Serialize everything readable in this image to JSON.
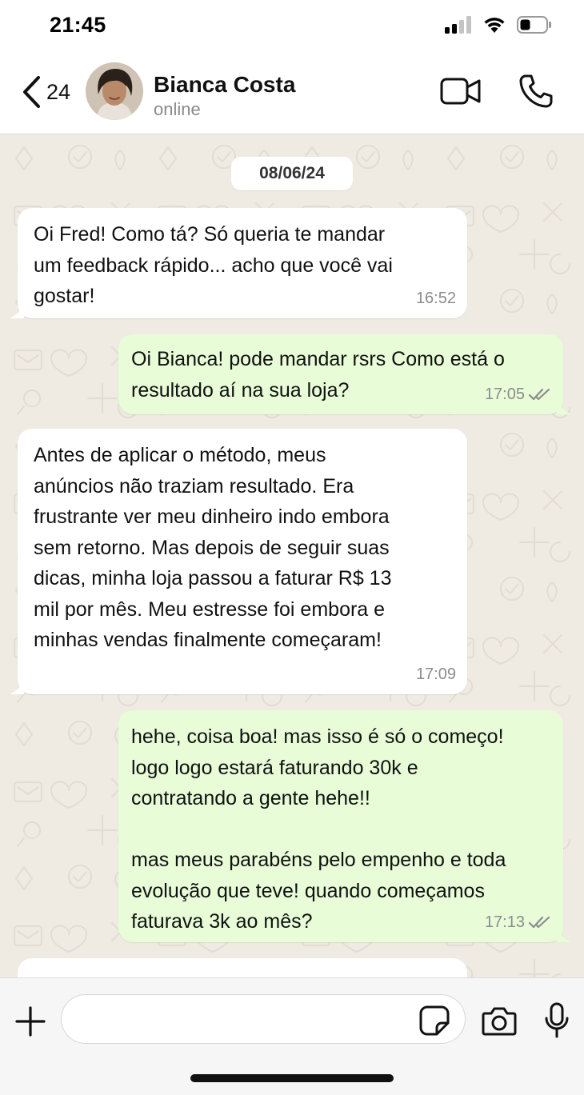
{
  "status_bar": {
    "time": "21:45"
  },
  "header": {
    "back_count": "24",
    "contact_name": "Bianca Costa",
    "contact_status": "online"
  },
  "chat": {
    "date": "08/06/24",
    "messages": [
      {
        "direction": "incoming",
        "text": "Oi Fred! Como tá? Só queria te mandar\num feedback rápido... acho que você vai\ngostar!",
        "time": "16:52"
      },
      {
        "direction": "outgoing",
        "text": "Oi Bianca! pode mandar rsrs Como está o\nresultado aí na sua loja?",
        "time": "17:05",
        "status": "read"
      },
      {
        "direction": "incoming",
        "text": "Antes de aplicar o método, meus\nanúncios não traziam resultado. Era\nfrustrante ver meu dinheiro indo embora\nsem retorno. Mas depois de seguir suas\ndicas, minha loja passou a faturar R$ 13\nmil por mês. Meu estresse foi embora e\nminhas vendas finalmente começaram!",
        "time": "17:09"
      },
      {
        "direction": "outgoing",
        "text": "hehe, coisa boa! mas isso é só o começo!\nlogo logo estará faturando 30k e\ncontratando a gente hehe!!\n\nmas meus parabéns pelo empenho e toda\nevolução que teve! quando começamos\nfaturava 3k ao mês?",
        "time": "17:13",
        "status": "read"
      }
    ]
  },
  "input_bar": {
    "placeholder": ""
  },
  "colors": {
    "incoming_bubble": "#ffffff",
    "outgoing_bubble": "#e7fcd7",
    "chat_background": "#efeae2",
    "read_ticks": "#8c8c8c"
  },
  "icons": {
    "back": "chevron-left-icon",
    "video": "video-camera-icon",
    "call": "phone-icon",
    "plus": "plus-icon",
    "sticker": "sticker-icon",
    "camera": "camera-icon",
    "mic": "microphone-icon",
    "read_receipt": "double-check-icon"
  }
}
